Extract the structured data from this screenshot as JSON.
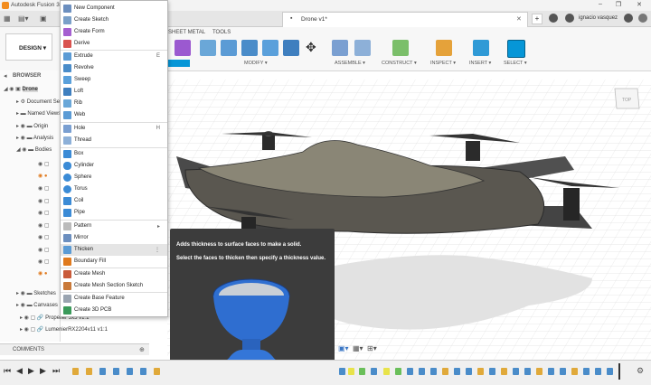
{
  "app": {
    "title": "Autodesk Fusion 360",
    "doc_tab": "Drone v1*",
    "user": "ignacio vasquez"
  },
  "toolbar": {
    "workspace": "DESIGN ▾",
    "tabs": [
      "SHEET METAL",
      "TOOLS"
    ],
    "groups": [
      "MODIFY ▾",
      "ASSEMBLE ▾",
      "CONSTRUCT ▾",
      "INSPECT ▾",
      "INSERT ▾",
      "SELECT ▾"
    ]
  },
  "browser": {
    "title": "BROWSER",
    "items": [
      "Drone",
      "Document Settings",
      "Named Views",
      "Origin",
      "Analysis",
      "Bodies",
      "Sketches",
      "Canvases"
    ],
    "bottom_items": [
      "Propeller 5x5 v1:1",
      "LumenierRX2204v11 v1:1"
    ]
  },
  "menu": {
    "items": [
      {
        "label": "New Component",
        "shortcut": ""
      },
      {
        "label": "Create Sketch",
        "shortcut": ""
      },
      {
        "label": "Create Form",
        "shortcut": ""
      },
      {
        "label": "Derive",
        "shortcut": ""
      },
      {
        "label": "Extrude",
        "shortcut": "E"
      },
      {
        "label": "Revolve",
        "shortcut": ""
      },
      {
        "label": "Sweep",
        "shortcut": ""
      },
      {
        "label": "Loft",
        "shortcut": ""
      },
      {
        "label": "Rib",
        "shortcut": ""
      },
      {
        "label": "Web",
        "shortcut": ""
      },
      {
        "label": "Hole",
        "shortcut": "H"
      },
      {
        "label": "Thread",
        "shortcut": ""
      },
      {
        "label": "Box",
        "shortcut": ""
      },
      {
        "label": "Cylinder",
        "shortcut": ""
      },
      {
        "label": "Sphere",
        "shortcut": ""
      },
      {
        "label": "Torus",
        "shortcut": ""
      },
      {
        "label": "Coil",
        "shortcut": ""
      },
      {
        "label": "Pipe",
        "shortcut": ""
      },
      {
        "label": "Pattern",
        "shortcut": "▸"
      },
      {
        "label": "Mirror",
        "shortcut": ""
      },
      {
        "label": "Thicken",
        "shortcut": "⋮"
      },
      {
        "label": "Boundary Fill",
        "shortcut": ""
      },
      {
        "label": "Create Mesh",
        "shortcut": ""
      },
      {
        "label": "Create Mesh Section Sketch",
        "shortcut": ""
      },
      {
        "label": "Create Base Feature",
        "shortcut": ""
      },
      {
        "label": "Create 3D PCB",
        "shortcut": ""
      }
    ]
  },
  "tooltip": {
    "line1": "Adds thickness to surface faces to make a solid.",
    "line2": "Select the faces to thicken then specify a thickness value."
  },
  "comments": {
    "label": "COMMENTS"
  },
  "colors": {
    "accent": "#0696d7",
    "menu_hover": "#e5e5e5",
    "tooltip_bg": "#3c3c3c"
  }
}
